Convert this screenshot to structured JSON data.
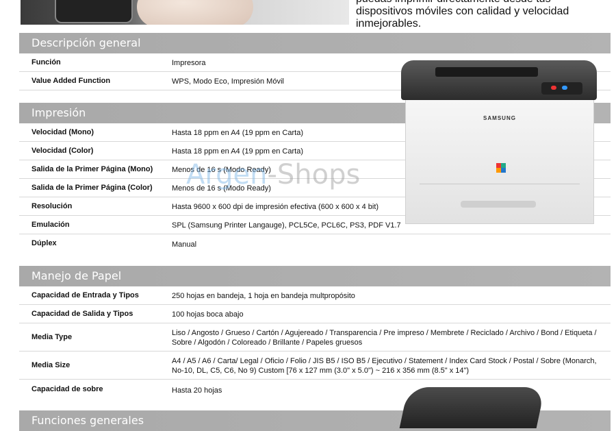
{
  "promo": {
    "line1": "puedas imprimir directamente desde tus",
    "line2": "dispositivos móviles con calidad y velocidad",
    "line3": "inmejorables."
  },
  "watermark": {
    "part1": "Argen",
    "part2": "-Shops"
  },
  "printer": {
    "brand": "SAMSUNG"
  },
  "sections": [
    {
      "title": "Descripción general",
      "rows": [
        {
          "label": "Función",
          "value": "Impresora"
        },
        {
          "label": "Value Added Function",
          "value": "WPS, Modo Eco, Impresión Móvil"
        }
      ]
    },
    {
      "title": "Impresión",
      "rows": [
        {
          "label": "Velocidad (Mono)",
          "value": "Hasta 18 ppm en A4 (19 ppm en Carta)"
        },
        {
          "label": "Velocidad (Color)",
          "value": "Hasta 18 ppm en A4 (19 ppm en Carta)"
        },
        {
          "label": "Salida de la Primer Página (Mono)",
          "value": "Menos de 16 s (Modo Ready)"
        },
        {
          "label": "Salida de la Primer Página (Color)",
          "value": "Menos de 16 s (Modo Ready)"
        },
        {
          "label": "Resolución",
          "value": "Hasta 9600 x 600 dpi de impresión efectiva (600 x 600 x 4 bit)"
        },
        {
          "label": "Emulación",
          "value": "SPL (Samsung Printer Langauge), PCL5Ce, PCL6C, PS3, PDF V1.7"
        },
        {
          "label": "Dúplex",
          "value": "Manual"
        }
      ]
    },
    {
      "title": "Manejo de Papel",
      "rows": [
        {
          "label": "Capacidad de Entrada y Tipos",
          "value": "250 hojas en bandeja, 1 hoja en bandeja multpropósito"
        },
        {
          "label": "Capacidad de Salida y Tipos",
          "value": "100 hojas boca abajo"
        },
        {
          "label": "Media Type",
          "value": "Liso / Angosto / Grueso / Cartón / Agujereado / Transparencia / Pre impreso / Membrete / Reciclado / Archivo / Bond / Etiqueta / Sobre / Algodón / Coloreado / Brillante / Papeles gruesos"
        },
        {
          "label": "Media Size",
          "value": "A4 / A5 / A6 / Carta/ Legal / Oficio / Folio / JIS B5 / ISO B5 / Ejecutivo / Statement / Index Card Stock / Postal / Sobre (Monarch, No-10, DL, C5, C6, No 9) Custom [76 x 127 mm (3.0\" x 5.0\") ~ 216 x 356 mm (8.5\" x 14\")"
        },
        {
          "label": "Capacidad de sobre",
          "value": "Hasta 20 hojas"
        }
      ]
    },
    {
      "title": "Funciones generales",
      "rows": []
    }
  ]
}
